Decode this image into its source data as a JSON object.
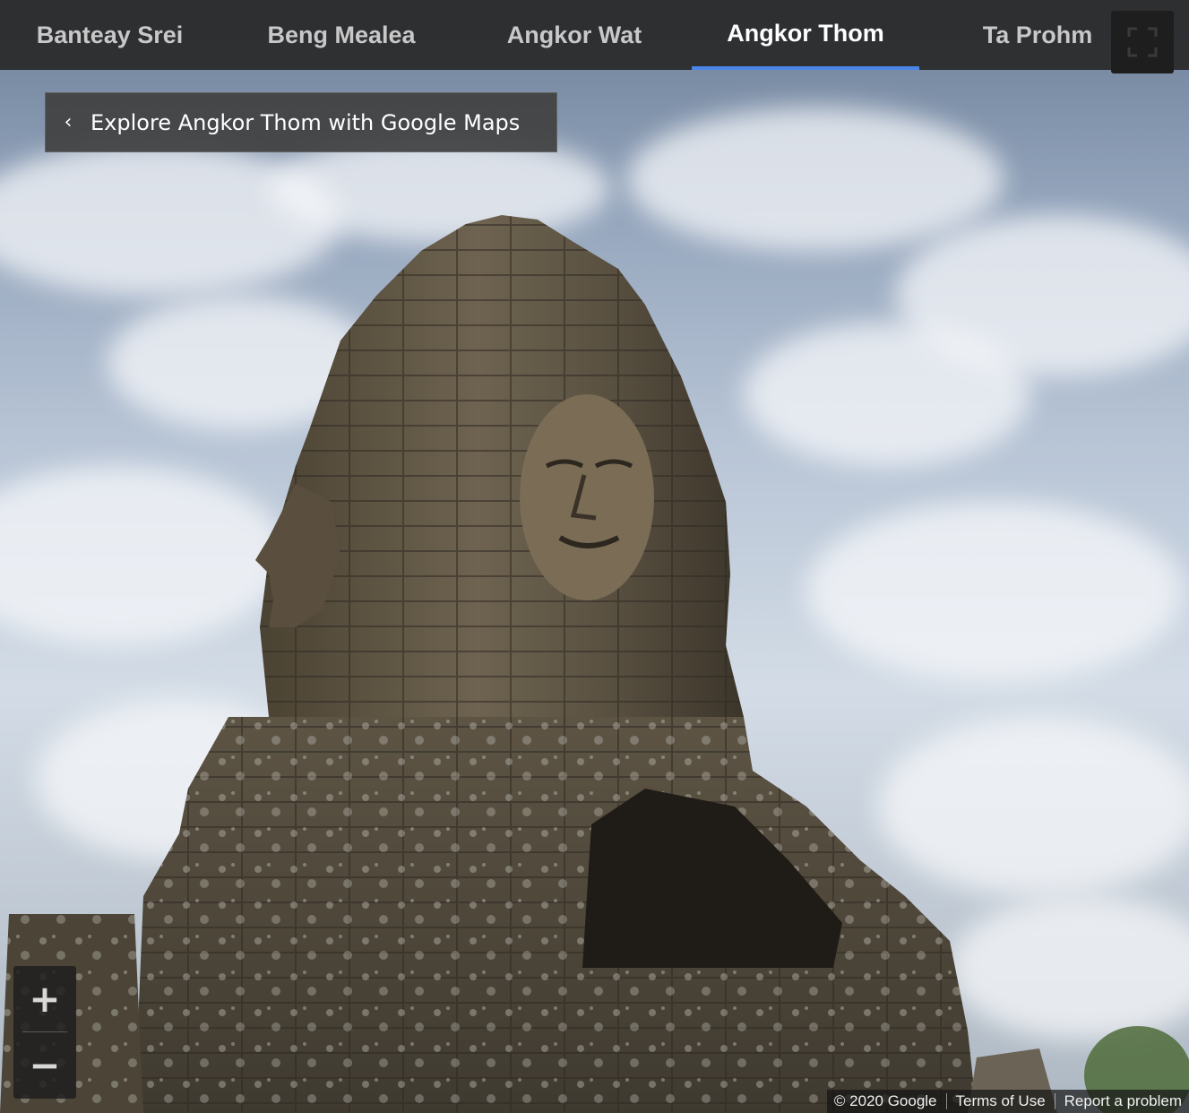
{
  "tabs": [
    {
      "label": "Banteay Srei",
      "active": false
    },
    {
      "label": "Beng Mealea",
      "active": false
    },
    {
      "label": "Angkor Wat",
      "active": false
    },
    {
      "label": "Angkor Thom",
      "active": true
    },
    {
      "label": "Ta Prohm",
      "active": false
    }
  ],
  "fullscreen": {
    "icon": "fullscreen-icon"
  },
  "explore": {
    "label": "Explore Angkor Thom with Google Maps",
    "icon": "chevron-left-icon"
  },
  "zoom": {
    "in_label": "+",
    "out_label": "−"
  },
  "footer": {
    "copyright": "© 2020 Google",
    "terms": "Terms of Use",
    "report": "Report a problem"
  },
  "colors": {
    "active_tab_underline": "#4a86e8",
    "tabbar_bg": "#282828"
  }
}
